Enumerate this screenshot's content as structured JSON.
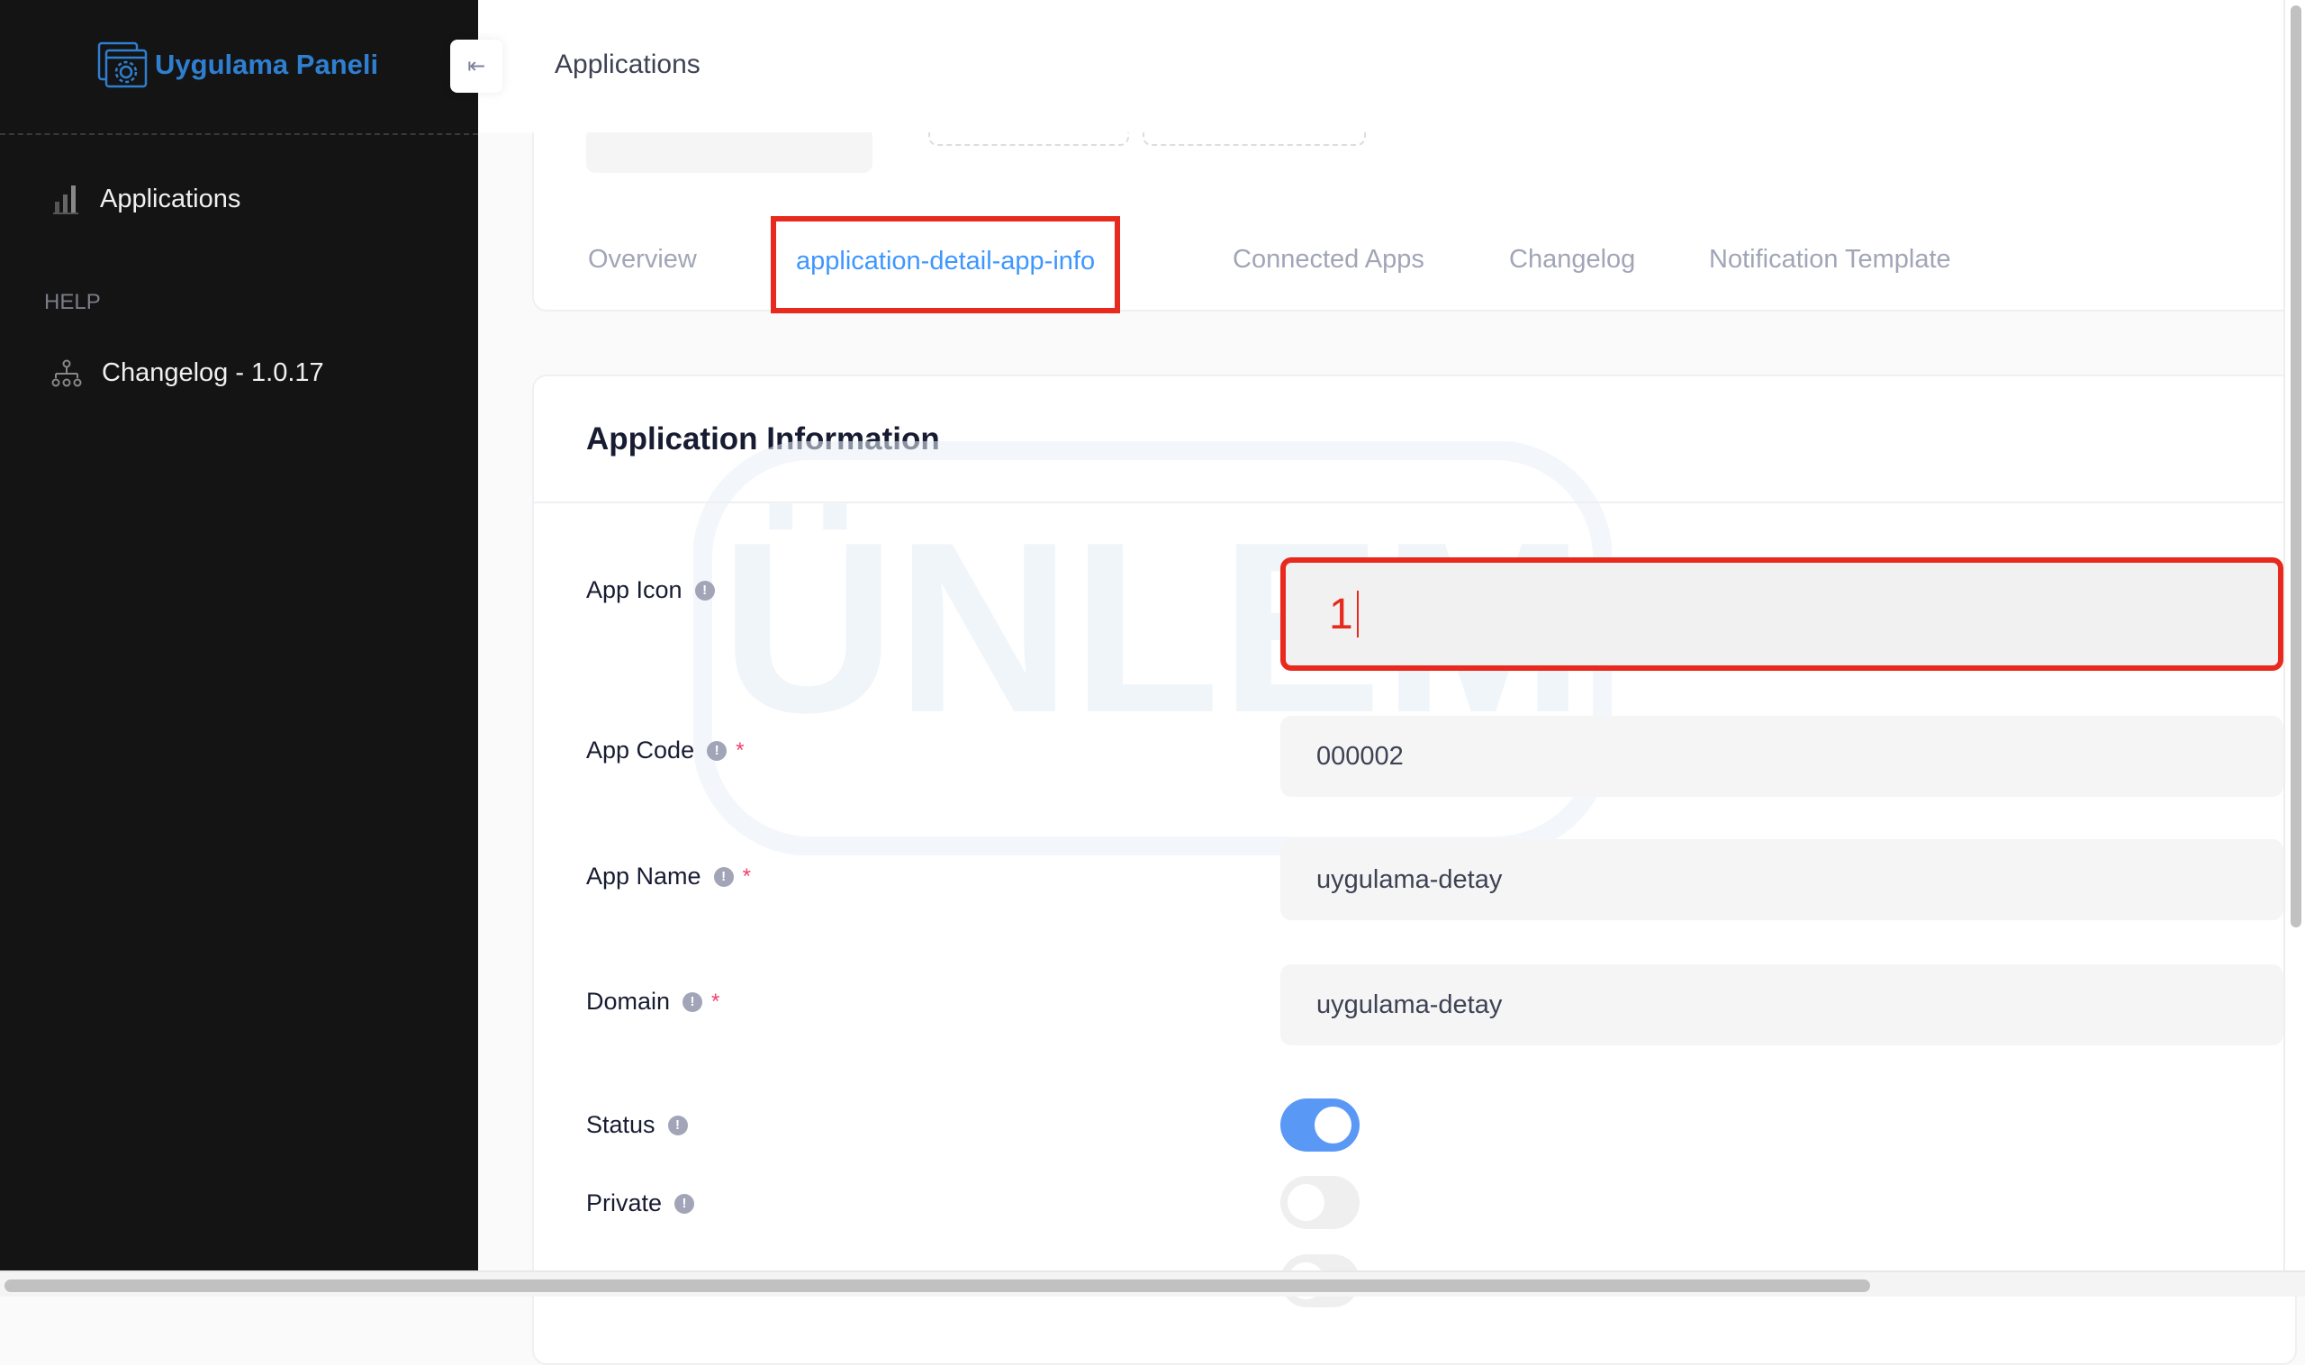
{
  "sidebar": {
    "brand": "Uygulama Paneli",
    "items": [
      {
        "label": "Applications",
        "icon": "bar-chart-icon"
      }
    ],
    "help_section": "HELP",
    "help_items": [
      {
        "label": "Changelog - 1.0.17",
        "icon": "sitemap-icon"
      }
    ]
  },
  "header": {
    "title": "Applications"
  },
  "tabs": [
    {
      "label": "Overview"
    },
    {
      "label": "application-detail-app-info",
      "active": true
    },
    {
      "label": "Connected Apps"
    },
    {
      "label": "Changelog"
    },
    {
      "label": "Notification Template"
    }
  ],
  "form": {
    "title": "Application Information",
    "fields": [
      {
        "label": "App Icon",
        "value": "1",
        "required": false
      },
      {
        "label": "App Code",
        "value": "000002",
        "required": true
      },
      {
        "label": "App Name",
        "value": "uygulama-detay",
        "required": true
      },
      {
        "label": "Domain",
        "value": "uygulama-detay",
        "required": true
      },
      {
        "label": "Status",
        "toggle": true
      },
      {
        "label": "Private",
        "toggle": false
      }
    ],
    "info_glyph": "!",
    "required_mark": "*"
  },
  "watermark": "ÜNLEM",
  "colors": {
    "accent": "#3e97ff",
    "highlight": "#e8291e",
    "toggle_on": "#5a98f5",
    "sidebar_bg": "#141414"
  }
}
